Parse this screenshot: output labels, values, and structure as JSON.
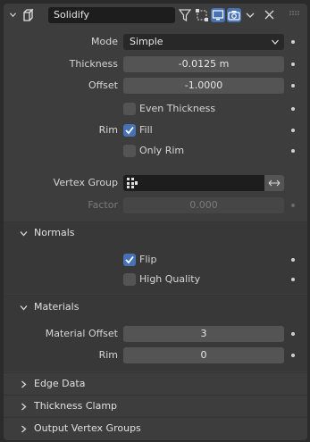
{
  "modifier": {
    "name": "Solidify"
  },
  "main": {
    "mode_label": "Mode",
    "mode_value": "Simple",
    "thickness_label": "Thickness",
    "thickness_value": "-0.0125 m",
    "offset_label": "Offset",
    "offset_value": "-1.0000",
    "even_thickness_label": "Even Thickness",
    "even_thickness_checked": false,
    "rim_label": "Rim",
    "fill_label": "Fill",
    "fill_checked": true,
    "only_rim_label": "Only Rim",
    "only_rim_checked": false,
    "vertex_group_label": "Vertex Group",
    "vertex_group_value": "",
    "factor_label": "Factor",
    "factor_value": "0.000"
  },
  "normals": {
    "title": "Normals",
    "flip_label": "Flip",
    "flip_checked": true,
    "high_quality_label": "High Quality",
    "high_quality_checked": false
  },
  "materials": {
    "title": "Materials",
    "material_offset_label": "Material Offset",
    "material_offset_value": "3",
    "rim_label": "Rim",
    "rim_value": "0"
  },
  "collapsed_panels": [
    {
      "title": "Edge Data"
    },
    {
      "title": "Thickness Clamp"
    },
    {
      "title": "Output Vertex Groups"
    }
  ],
  "colors": {
    "accent": "#4772b3",
    "panel_bg": "#3d3d3d",
    "field_bg": "#545454",
    "dark_field_bg": "#1d1d1d"
  },
  "icons": [
    "chevron-down-icon",
    "solidify-modifier-icon",
    "funnel-icon",
    "edit-mode-icon",
    "realtime-display-icon",
    "render-camera-icon",
    "close-icon",
    "drag-grip-icon",
    "vertex-group-icon",
    "swap-arrows-icon",
    "check-icon",
    "chevron-right-icon",
    "decorator-dot-icon"
  ]
}
